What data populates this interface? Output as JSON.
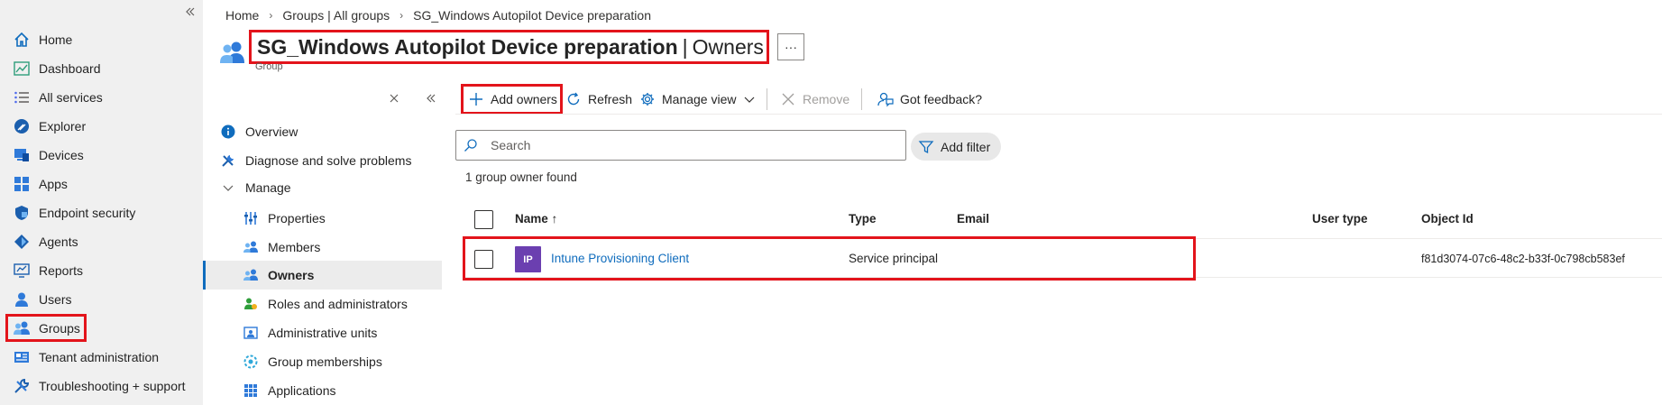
{
  "left_nav": {
    "collapse_icon": "double-chevron-left-icon",
    "items": [
      {
        "label": "Home",
        "icon": "home-icon"
      },
      {
        "label": "Dashboard",
        "icon": "dashboard-icon"
      },
      {
        "label": "All services",
        "icon": "list-icon"
      },
      {
        "label": "Explorer",
        "icon": "explorer-icon"
      },
      {
        "label": "Devices",
        "icon": "devices-icon"
      },
      {
        "label": "Apps",
        "icon": "apps-icon"
      },
      {
        "label": "Endpoint security",
        "icon": "shield-icon"
      },
      {
        "label": "Agents",
        "icon": "agents-icon"
      },
      {
        "label": "Reports",
        "icon": "reports-icon"
      },
      {
        "label": "Users",
        "icon": "user-icon"
      },
      {
        "label": "Groups",
        "icon": "groups-icon"
      },
      {
        "label": "Tenant administration",
        "icon": "tenant-admin-icon"
      },
      {
        "label": "Troubleshooting + support",
        "icon": "troubleshooting-icon"
      }
    ]
  },
  "breadcrumb": [
    "Home",
    "Groups | All groups",
    "SG_Windows Autopilot Device preparation"
  ],
  "header": {
    "title": "SG_Windows Autopilot Device preparation",
    "section": "Owners",
    "separator": "|",
    "subtitle": "Group",
    "more_label": "···"
  },
  "resource_menu": {
    "items": [
      {
        "label": "Overview",
        "icon": "info-icon"
      },
      {
        "label": "Diagnose and solve problems",
        "icon": "wrench-icon"
      },
      {
        "label": "Manage",
        "icon": "chevron-down-icon"
      },
      {
        "label": "Properties",
        "icon": "properties-icon"
      },
      {
        "label": "Members",
        "icon": "members-icon"
      },
      {
        "label": "Owners",
        "icon": "owners-icon"
      },
      {
        "label": "Roles and administrators",
        "icon": "roles-icon"
      },
      {
        "label": "Administrative units",
        "icon": "admin-units-icon"
      },
      {
        "label": "Group memberships",
        "icon": "group-memberships-icon"
      },
      {
        "label": "Applications",
        "icon": "applications-icon"
      }
    ],
    "selected": "Owners"
  },
  "toolbar": {
    "add_owners": "Add owners",
    "refresh": "Refresh",
    "manage_view": "Manage view",
    "remove": "Remove",
    "feedback": "Got feedback?"
  },
  "search": {
    "placeholder": "Search"
  },
  "filter": {
    "label": "Add filter"
  },
  "result_count": "1 group owner found",
  "table": {
    "columns": [
      "Name ↑",
      "Type",
      "Email",
      "User type",
      "Object Id"
    ],
    "rows": [
      {
        "initials": "IP",
        "name": "Intune Provisioning Client",
        "type": "Service principal",
        "email": "",
        "user_type": "",
        "object_id": "f81d3074-07c6-48c2-b33f-0c798cb583ef"
      }
    ]
  },
  "colors": {
    "accent": "#0f6cbd",
    "highlight": "#e3141b",
    "avatar": "#6b3fb0"
  }
}
